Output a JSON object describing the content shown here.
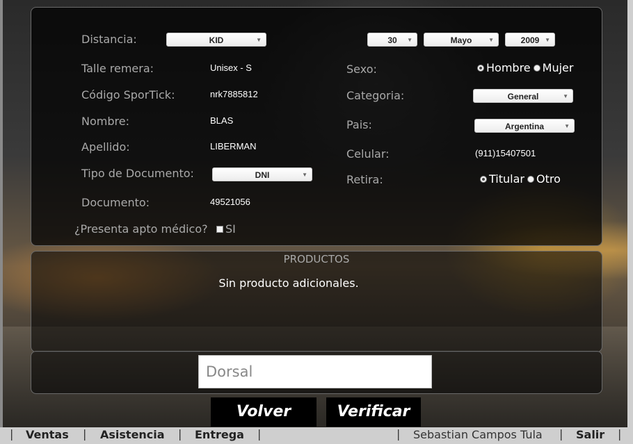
{
  "form": {
    "distancia": {
      "label": "Distancia:",
      "value": "KID"
    },
    "fecha": {
      "day": "30",
      "month": "Mayo",
      "year": "2009"
    },
    "talle": {
      "label": "Talle remera:",
      "value": "Unisex - S"
    },
    "codigo": {
      "label": "Código SporTick:",
      "value": "nrk7885812"
    },
    "nombre": {
      "label": "Nombre:",
      "value": "BLAS"
    },
    "apellido": {
      "label": "Apellido:",
      "value": "LIBERMAN"
    },
    "tipo_doc": {
      "label": "Tipo de Documento:",
      "value": "DNI"
    },
    "documento": {
      "label": "Documento:",
      "value": "49521056"
    },
    "apto": {
      "label": "¿Presenta apto médico?",
      "option": "SI",
      "checked": false
    },
    "sexo": {
      "label": "Sexo:",
      "options": [
        "Hombre",
        "Mujer"
      ],
      "selected": "Hombre"
    },
    "categoria": {
      "label": "Categoria:",
      "value": "General"
    },
    "pais": {
      "label": "Pais:",
      "value": "Argentina"
    },
    "celular": {
      "label": "Celular:",
      "value": "(911)15407501"
    },
    "retira": {
      "label": "Retira:",
      "options": [
        "Titular",
        "Otro"
      ],
      "selected": "Titular"
    }
  },
  "productos": {
    "title": "PRODUCTOS",
    "message": "Sin producto adicionales."
  },
  "dorsal": {
    "placeholder": "Dorsal",
    "value": ""
  },
  "buttons": {
    "volver": "Volver",
    "verificar": "Verificar"
  },
  "footer": {
    "nav": [
      "Ventas",
      "Asistencia",
      "Entrega"
    ],
    "user": "Sebastian Campos Tula",
    "salir": "Salir"
  },
  "icons": {
    "dropdown": "chevron-down-icon"
  }
}
